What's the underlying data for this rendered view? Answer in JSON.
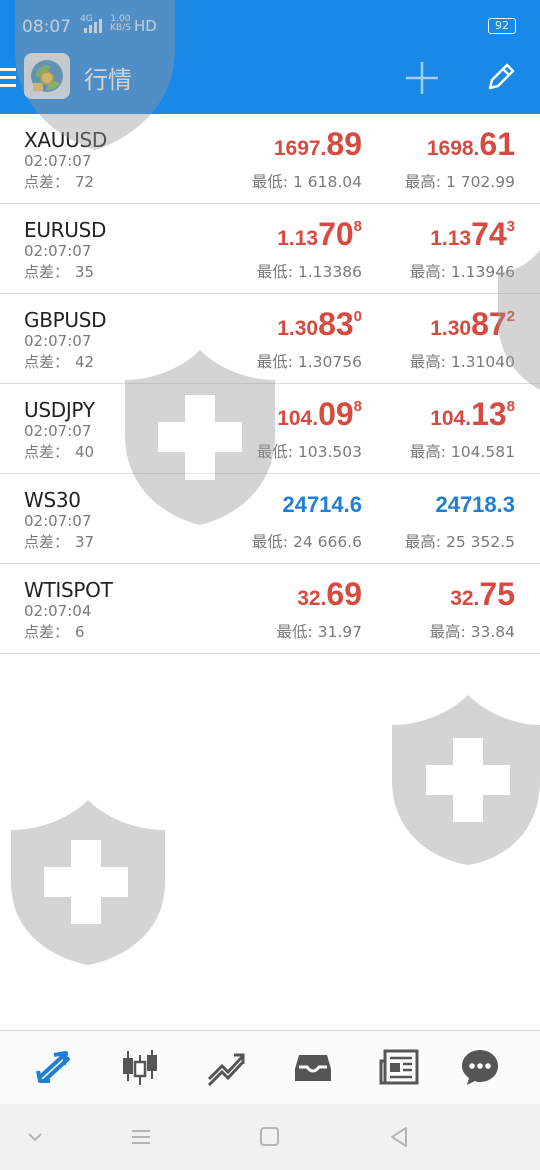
{
  "status_bar": {
    "time": "08:07",
    "network": "4G",
    "speed_value": "1.00",
    "speed_unit": "KB/S",
    "hd": "HD",
    "battery": "92"
  },
  "app_bar": {
    "title": "行情",
    "icons": [
      "menu-icon",
      "app-logo",
      "add-icon",
      "edit-icon"
    ]
  },
  "labels": {
    "spread": "点差：",
    "low": "最低:",
    "high": "最高:"
  },
  "colors": {
    "header_blue": "#1a88e6",
    "price_red": "#d64a3f",
    "price_blue": "#1f7fd6",
    "nav_active": "#1f7fd6"
  },
  "quotes": [
    {
      "symbol": "XAUUSD",
      "time": "02:07:07",
      "spread": "72",
      "color": "red",
      "bid": {
        "small": "1697.",
        "big": "89",
        "sup": ""
      },
      "ask": {
        "small": "1698.",
        "big": "61",
        "sup": ""
      },
      "low": "1 618.04",
      "high": "1 702.99"
    },
    {
      "symbol": "EURUSD",
      "time": "02:07:07",
      "spread": "35",
      "color": "red",
      "bid": {
        "small": "1.13",
        "big": "70",
        "sup": "8"
      },
      "ask": {
        "small": "1.13",
        "big": "74",
        "sup": "3"
      },
      "low": "1.13386",
      "high": "1.13946"
    },
    {
      "symbol": "GBPUSD",
      "time": "02:07:07",
      "spread": "42",
      "color": "red",
      "bid": {
        "small": "1.30",
        "big": "83",
        "sup": "0"
      },
      "ask": {
        "small": "1.30",
        "big": "87",
        "sup": "2"
      },
      "low": "1.30756",
      "high": "1.31040"
    },
    {
      "symbol": "USDJPY",
      "time": "02:07:07",
      "spread": "40",
      "color": "red",
      "bid": {
        "small": "104.",
        "big": "09",
        "sup": "8"
      },
      "ask": {
        "small": "104.",
        "big": "13",
        "sup": "8"
      },
      "low": "103.503",
      "high": "104.581"
    },
    {
      "symbol": "WS30",
      "time": "02:07:07",
      "spread": "37",
      "color": "blue",
      "bid": {
        "plain": "24714.6"
      },
      "ask": {
        "plain": "24718.3"
      },
      "low": "24 666.6",
      "high": "25 352.5"
    },
    {
      "symbol": "WTISPOT",
      "time": "02:07:04",
      "spread": "6",
      "color": "red",
      "bid": {
        "small": "32.",
        "big": "69",
        "sup": ""
      },
      "ask": {
        "small": "32.",
        "big": "75",
        "sup": ""
      },
      "low": "31.97",
      "high": "33.84"
    }
  ],
  "bottom_nav": {
    "items": [
      "quotes-icon",
      "chart-icon",
      "trade-icon",
      "history-icon",
      "news-icon",
      "chat-icon"
    ],
    "active": "quotes-icon"
  },
  "system_nav": {
    "items": [
      "chevron-down-icon",
      "recents-icon",
      "home-icon",
      "back-icon"
    ]
  }
}
